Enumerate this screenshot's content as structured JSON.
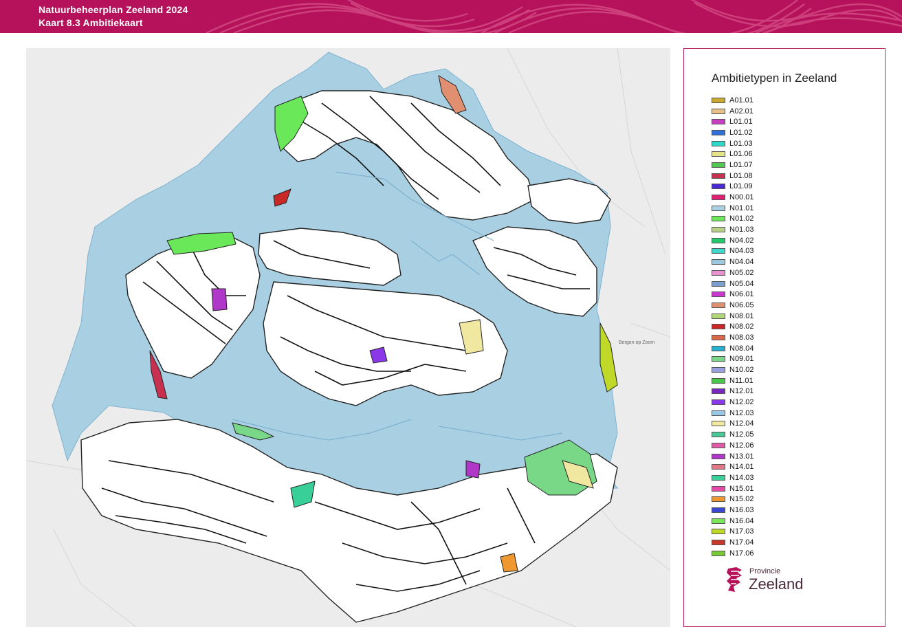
{
  "header": {
    "line1": "Natuurbeheerplan Zeeland 2024",
    "line2": "Kaart 8.3 Ambitiekaart",
    "color": "#b5125b"
  },
  "map": {
    "water_color": "#a8cfe2",
    "land_color": "#ffffff",
    "background_color": "#ececec",
    "place_label": "Bergen op Zoom"
  },
  "legend": {
    "title": "Ambitietypen in Zeeland",
    "items": [
      {
        "code": "A01.01",
        "color": "#c9a832"
      },
      {
        "code": "A02.01",
        "color": "#e8c08a"
      },
      {
        "code": "L01.01",
        "color": "#c83ec0"
      },
      {
        "code": "L01.02",
        "color": "#2f6fd8"
      },
      {
        "code": "L01.03",
        "color": "#2ed8c8"
      },
      {
        "code": "L01.06",
        "color": "#e8e48a"
      },
      {
        "code": "L01.07",
        "color": "#52c852"
      },
      {
        "code": "L01.08",
        "color": "#c83050"
      },
      {
        "code": "L01.09",
        "color": "#4a2ad0"
      },
      {
        "code": "N00.01",
        "color": "#e02070"
      },
      {
        "code": "N01.01",
        "color": "#a8cfe2"
      },
      {
        "code": "N01.02",
        "color": "#6ae85a"
      },
      {
        "code": "N01.03",
        "color": "#b8d088"
      },
      {
        "code": "N04.02",
        "color": "#22c86a"
      },
      {
        "code": "N04.03",
        "color": "#3ed8c8"
      },
      {
        "code": "N04.04",
        "color": "#9cc8e0"
      },
      {
        "code": "N05.02",
        "color": "#e890d0"
      },
      {
        "code": "N05.04",
        "color": "#7aa0d0"
      },
      {
        "code": "N06.01",
        "color": "#c838d0"
      },
      {
        "code": "N06.05",
        "color": "#e09070"
      },
      {
        "code": "N08.01",
        "color": "#b0d878"
      },
      {
        "code": "N08.02",
        "color": "#c82828"
      },
      {
        "code": "N08.03",
        "color": "#d86848"
      },
      {
        "code": "N08.04",
        "color": "#28b0d0"
      },
      {
        "code": "N09.01",
        "color": "#78d888"
      },
      {
        "code": "N10.02",
        "color": "#98a0e0"
      },
      {
        "code": "N11.01",
        "color": "#48c848"
      },
      {
        "code": "N12.01",
        "color": "#7a28c0"
      },
      {
        "code": "N12.02",
        "color": "#8a38e8"
      },
      {
        "code": "N12.03",
        "color": "#98c8e8"
      },
      {
        "code": "N12.04",
        "color": "#f0e8a0"
      },
      {
        "code": "N12.05",
        "color": "#48c898"
      },
      {
        "code": "N12.06",
        "color": "#e058a8"
      },
      {
        "code": "N13.01",
        "color": "#b038c8"
      },
      {
        "code": "N14.01",
        "color": "#e07888"
      },
      {
        "code": "N14.03",
        "color": "#38d098"
      },
      {
        "code": "N15.01",
        "color": "#e848a8"
      },
      {
        "code": "N15.02",
        "color": "#f09830"
      },
      {
        "code": "N16.03",
        "color": "#3848d0"
      },
      {
        "code": "N16.04",
        "color": "#78e858"
      },
      {
        "code": "N17.03",
        "color": "#c0d828"
      },
      {
        "code": "N17.04",
        "color": "#c83828"
      },
      {
        "code": "N17.06",
        "color": "#78c838"
      }
    ]
  },
  "logo": {
    "small": "Provincie",
    "big": "Zeeland",
    "color": "#b5125b"
  }
}
